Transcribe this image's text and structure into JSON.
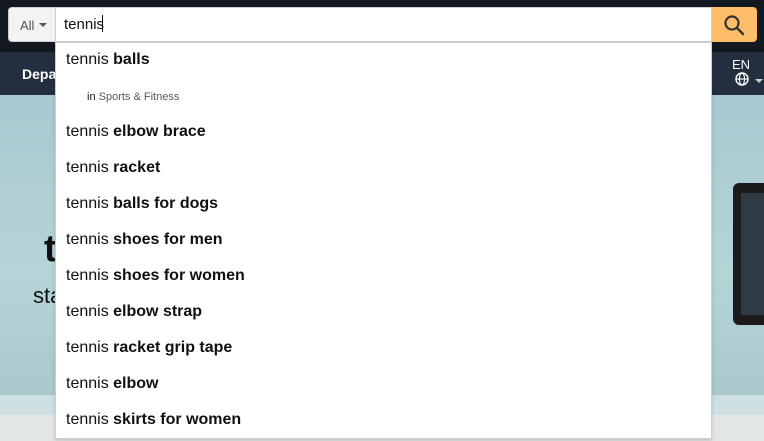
{
  "search": {
    "category": "All",
    "query": "tennis",
    "colors": {
      "button": "#febd69",
      "header": "#131921",
      "nav": "#232f3e"
    }
  },
  "nav": {
    "departments": "Departments"
  },
  "language": {
    "code": "EN"
  },
  "hero": {
    "big_text": "t",
    "small_text": "sta"
  },
  "suggestions": [
    {
      "prefix": "tennis",
      "completion": "balls"
    },
    {
      "prefix": "tennis",
      "completion": "elbow brace"
    },
    {
      "prefix": "tennis",
      "completion": "racket"
    },
    {
      "prefix": "tennis",
      "completion": "balls for dogs"
    },
    {
      "prefix": "tennis",
      "completion": "shoes for men"
    },
    {
      "prefix": "tennis",
      "completion": "shoes for women"
    },
    {
      "prefix": "tennis",
      "completion": "elbow strap"
    },
    {
      "prefix": "tennis",
      "completion": "racket grip tape"
    },
    {
      "prefix": "tennis",
      "completion": "elbow"
    },
    {
      "prefix": "tennis",
      "completion": "skirts for women"
    }
  ],
  "category_hint": {
    "in_label": "in",
    "category": "Sports & Fitness"
  }
}
